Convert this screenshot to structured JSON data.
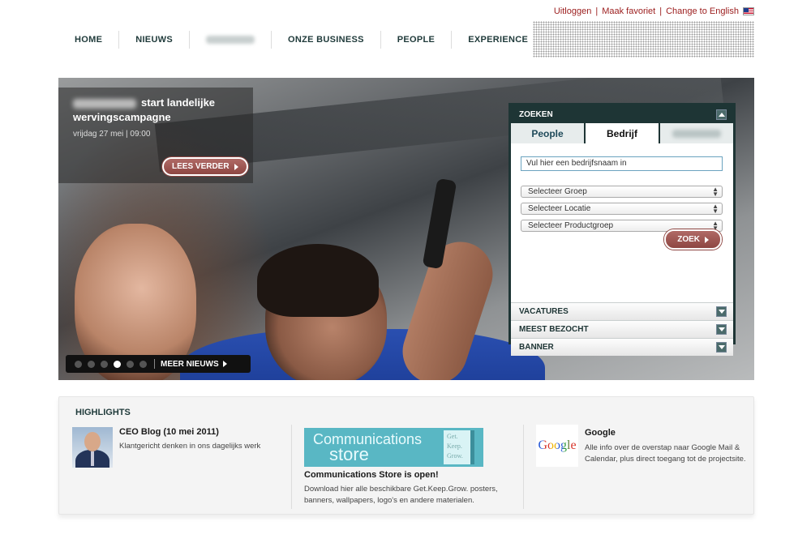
{
  "utility": {
    "logout": "Uitloggen",
    "favorite": "Maak favoriet",
    "language": "Change to English",
    "separator": "|"
  },
  "nav": {
    "items": [
      "HOME",
      "NIEUWS",
      "ONZE BUSINESS",
      "PEOPLE",
      "EXPERIENCE"
    ]
  },
  "hero": {
    "news_title_line1": "start landelijke",
    "news_title_line2": "wervingscampagne",
    "news_date": "vrijdag 27 mei | 09:00",
    "read_more": "LEES VERDER",
    "more_news": "MEER NIEUWS",
    "slide_count": 6,
    "active_slide": 4
  },
  "search": {
    "header": "ZOEKEN",
    "tabs": [
      "People",
      "Bedrijf"
    ],
    "active_tab": "Bedrijf",
    "input_value": "Vul hier een bedrijfsnaam in",
    "selects": [
      "Selecteer Groep",
      "Selecteer Locatie",
      "Selecteer Productgroep"
    ],
    "submit": "ZOEK",
    "accordion": [
      "VACATURES",
      "MEEST BEZOCHT",
      "BANNER"
    ]
  },
  "highlights": {
    "heading": "HIGHLIGHTS",
    "blog": {
      "title": "CEO Blog (10 mei 2011)",
      "text": "Klantgericht denken in ons dagelijks werk"
    },
    "store": {
      "banner_line1": "Communications",
      "banner_line2": "store",
      "banner_box": [
        "Get.",
        "Keep.",
        "Grow."
      ],
      "title": "Communications Store is open!",
      "text": "Download hier alle beschikbare Get.Keep.Grow. posters, banners, wallpapers, logo's en andere materialen."
    },
    "google": {
      "logo": "Google",
      "title": "Google",
      "text": "Alle info over de overstap naar Google Mail & Calendar, plus direct toegang tot de projectsite."
    }
  },
  "colors": {
    "accent_red": "#9b1c1c",
    "panel_dark": "#1e3535",
    "nav_text": "#1f3a3a",
    "store_teal": "#59b7c4"
  }
}
